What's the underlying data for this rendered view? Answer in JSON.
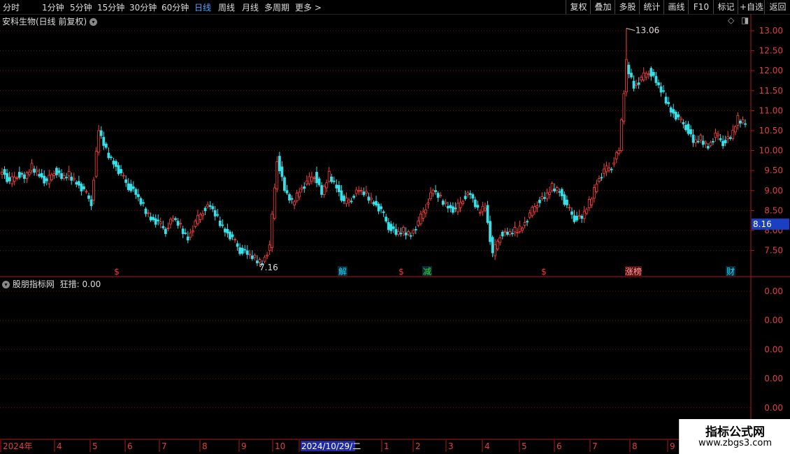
{
  "toolbar": {
    "periods": [
      "分时",
      "1分钟",
      "5分钟",
      "15分钟",
      "30分钟",
      "60分钟",
      "日线",
      "周线",
      "月线",
      "多周期",
      "更多 >"
    ],
    "active_period": "日线",
    "actions": [
      "复权",
      "叠加",
      "多股",
      "统计",
      "画线",
      "F10",
      "标记",
      "+自选",
      "返回"
    ]
  },
  "main_header": {
    "title": "安科生物(日线 前复权)"
  },
  "indicator_header": {
    "title": "股朋指标网",
    "value_text": "狂措: 0.00"
  },
  "markers": [
    {
      "label": "$",
      "color": "#ff3b3b"
    },
    {
      "label": "解",
      "color": "#00e0ff"
    },
    {
      "label": "$",
      "color": "#ff3b3b"
    },
    {
      "label": "减",
      "color": "#33dd33"
    },
    {
      "label": "$",
      "color": "#ff3b3b"
    },
    {
      "label": "涨榜",
      "color": "#ffa0a0"
    },
    {
      "label": "财",
      "color": "#00e0ff"
    }
  ],
  "annotations": {
    "high": "13.06",
    "low": "7.16"
  },
  "current_price": "8.16",
  "price_axis_labels": [
    "13.00",
    "12.50",
    "12.00",
    "11.50",
    "11.00",
    "10.50",
    "10.00",
    "9.50",
    "9.00",
    "8.50",
    "8.00",
    "7.50"
  ],
  "indicator_axis_labels": [
    "0.00",
    "0.00",
    "0.00",
    "0.00",
    "0.00"
  ],
  "time_axis": [
    "2024年",
    "4",
    "5",
    "6",
    "7",
    "8",
    "9",
    "10",
    "2024/10/29/二",
    "1",
    "2",
    "3",
    "4",
    "5",
    "6",
    "7",
    "8",
    "9"
  ],
  "watermark": {
    "line1": "指标公式网",
    "line2": "www.zbgs3.com"
  },
  "colors": {
    "up": "#ff4040",
    "down": "#36e0e8",
    "grid": "#7a1010",
    "axis": "#b01818",
    "current": "#1a3fc2"
  },
  "chart_data": {
    "type": "candlestick",
    "title": "安科生物(日线 前复权)",
    "ylim": [
      7.0,
      13.3
    ],
    "x_labels": [
      "2024年",
      "4",
      "5",
      "6",
      "7",
      "8",
      "9",
      "10",
      "2024/10/29/二",
      "1",
      "2",
      "3",
      "4",
      "5",
      "6",
      "7",
      "8",
      "9"
    ],
    "close_series_approx": [
      9.5,
      9.2,
      9.4,
      9.3,
      9.6,
      9.4,
      9.2,
      9.5,
      9.3,
      9.4,
      9.2,
      9.0,
      8.7,
      10.5,
      10.0,
      9.7,
      9.4,
      9.1,
      8.9,
      8.6,
      8.3,
      8.2,
      8.0,
      8.3,
      8.1,
      7.8,
      8.2,
      8.5,
      8.6,
      8.3,
      8.0,
      7.8,
      7.5,
      7.4,
      7.3,
      7.2,
      7.6,
      9.8,
      9.0,
      8.7,
      9.0,
      9.2,
      9.4,
      8.9,
      9.4,
      9.1,
      8.7,
      8.8,
      9.0,
      8.9,
      8.7,
      8.5,
      8.1,
      7.9,
      8.0,
      7.9,
      8.2,
      8.6,
      9.0,
      8.8,
      8.6,
      8.5,
      8.8,
      8.9,
      8.5,
      8.6,
      7.4,
      7.9,
      7.9,
      8.0,
      8.1,
      8.4,
      8.7,
      8.8,
      9.1,
      9.0,
      8.6,
      8.3,
      8.3,
      8.7,
      9.2,
      9.5,
      9.6,
      10.0,
      12.2,
      11.6,
      11.8,
      12.0,
      11.7,
      11.4,
      11.0,
      10.8,
      10.6,
      10.2,
      10.3,
      10.1,
      10.4,
      10.2,
      10.3,
      10.8,
      10.7
    ],
    "high": 13.06,
    "low": 7.16,
    "last": 8.16,
    "indicator": {
      "name": "狂措",
      "value": 0.0
    }
  }
}
